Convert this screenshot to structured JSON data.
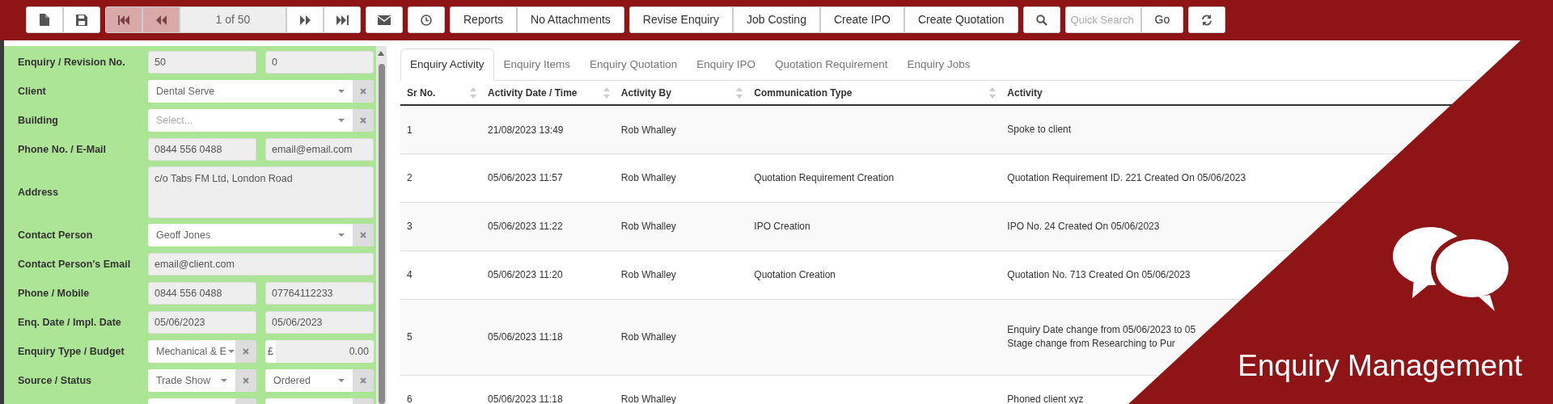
{
  "toolbar": {
    "groups": [
      {
        "items": [
          {
            "kind": "new",
            "disabled": false
          },
          {
            "kind": "save",
            "disabled": false
          }
        ]
      },
      {
        "items": [
          {
            "kind": "first",
            "disabled": true
          },
          {
            "kind": "prev",
            "disabled": true
          },
          {
            "kind": "pager",
            "label": "1 of 50"
          },
          {
            "kind": "next",
            "disabled": false
          },
          {
            "kind": "last",
            "disabled": false
          }
        ]
      },
      {
        "items": [
          {
            "kind": "email",
            "disabled": false
          }
        ]
      },
      {
        "items": [
          {
            "kind": "history",
            "disabled": false
          }
        ]
      },
      {
        "items": [
          {
            "kind": "text",
            "label": "Reports",
            "disabled": false
          },
          {
            "kind": "text",
            "label": "No Attachments",
            "disabled": false
          }
        ]
      },
      {
        "items": [
          {
            "kind": "text",
            "label": "Revise Enquiry",
            "disabled": false
          },
          {
            "kind": "text",
            "label": "Job Costing",
            "disabled": false
          },
          {
            "kind": "text",
            "label": "Create IPO",
            "disabled": false
          },
          {
            "kind": "text",
            "label": "Create Quotation",
            "disabled": false
          }
        ]
      },
      {
        "items": [
          {
            "kind": "search",
            "disabled": false
          }
        ]
      },
      {
        "items": [
          {
            "kind": "search-input",
            "placeholder": "Quick Search"
          },
          {
            "kind": "text",
            "label": "Go",
            "disabled": false
          }
        ]
      },
      {
        "items": [
          {
            "kind": "refresh",
            "disabled": false
          }
        ]
      }
    ]
  },
  "form": {
    "rows": [
      {
        "label": "Enquiry / Revision No.",
        "fields": [
          {
            "kind": "text",
            "value": "50"
          },
          {
            "kind": "text",
            "value": "0"
          }
        ]
      },
      {
        "label": "Client",
        "fields": [
          {
            "kind": "select",
            "value": "Dental Serve"
          }
        ]
      },
      {
        "label": "Building",
        "fields": [
          {
            "kind": "select",
            "placeholder": "Select..."
          }
        ]
      },
      {
        "label": "Phone No. / E-Mail",
        "fields": [
          {
            "kind": "text",
            "value": "0844 556 0488"
          },
          {
            "kind": "text",
            "value": "email@email.com"
          }
        ]
      },
      {
        "label": "Address",
        "fields": [
          {
            "kind": "textarea",
            "value": "c/o Tabs FM Ltd, London Road"
          }
        ]
      },
      {
        "label": "Contact Person",
        "fields": [
          {
            "kind": "select",
            "value": "Geoff Jones"
          }
        ]
      },
      {
        "label": "Contact Person's Email",
        "fields": [
          {
            "kind": "text",
            "value": "email@client.com"
          }
        ]
      },
      {
        "label": "Phone / Mobile",
        "fields": [
          {
            "kind": "text",
            "value": "0844 556 0488"
          },
          {
            "kind": "text",
            "value": "07764112233"
          }
        ]
      },
      {
        "label": "Enq. Date / Impl. Date",
        "fields": [
          {
            "kind": "text",
            "value": "05/06/2023"
          },
          {
            "kind": "text",
            "value": "05/06/2023"
          }
        ]
      },
      {
        "label": "Enquiry Type / Budget",
        "fields": [
          {
            "kind": "select",
            "value": "Mechanical & E"
          },
          {
            "kind": "currency",
            "symbol": "£",
            "value": "0.00"
          }
        ]
      },
      {
        "label": "Source / Status",
        "fields": [
          {
            "kind": "select",
            "value": "Trade Show"
          },
          {
            "kind": "select",
            "value": "Ordered"
          }
        ]
      },
      {
        "fields": [
          {
            "kind": "select"
          },
          {
            "kind": "select"
          }
        ]
      }
    ]
  },
  "tabs": [
    {
      "label": "Enquiry Activity",
      "selected": true
    },
    {
      "label": "Enquiry Items",
      "selected": false
    },
    {
      "label": "Enquiry Quotation",
      "selected": false
    },
    {
      "label": "Enquiry IPO",
      "selected": false
    },
    {
      "label": "Quotation Requirement",
      "selected": false
    },
    {
      "label": "Enquiry Jobs",
      "selected": false
    }
  ],
  "table": {
    "columns": [
      {
        "label": "Sr No.",
        "sortable": true
      },
      {
        "label": "Activity Date / Time",
        "sortable": true
      },
      {
        "label": "Activity By",
        "sortable": true
      },
      {
        "label": "Communication Type",
        "sortable": true
      },
      {
        "label": "Activity"
      }
    ],
    "rows": [
      {
        "sr": "1",
        "date": "21/08/2023 13:49",
        "by": "Rob Whalley",
        "activity": [
          "Spoke to client"
        ]
      },
      {
        "sr": "2",
        "date": "05/06/2023 11:57",
        "by": "Rob Whalley",
        "type": "Quotation Requirement Creation",
        "activity": [
          "Quotation Requirement ID. 221 Created On 05/06/2023"
        ]
      },
      {
        "sr": "3",
        "date": "05/06/2023 11:22",
        "by": "Rob Whalley",
        "type": "IPO Creation",
        "activity": [
          "IPO No. 24 Created On 05/06/2023"
        ]
      },
      {
        "sr": "4",
        "date": "05/06/2023 11:20",
        "by": "Rob Whalley",
        "type": "Quotation Creation",
        "activity": [
          "Quotation No. 713 Created On 05/06/2023"
        ]
      },
      {
        "sr": "5",
        "date": "05/06/2023 11:18",
        "by": "Rob Whalley",
        "activity": [
          "Enquiry Date change from 05/06/2023 to 05",
          "Stage change from Researching to Pur"
        ]
      },
      {
        "sr": "6",
        "date": "05/06/2023 11:18",
        "by": "Rob Whalley",
        "activity": [
          "Phoned client xyz"
        ]
      }
    ]
  },
  "banner": {
    "title": "Enquiry Management"
  }
}
